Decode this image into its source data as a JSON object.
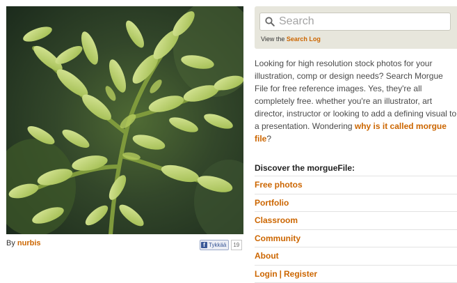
{
  "photo": {
    "credit_prefix": "By",
    "author": "nurbis",
    "like_label": "Tykkää",
    "like_count": "19"
  },
  "search": {
    "placeholder": "Search",
    "log_prefix": "View the",
    "log_link": "Search Log"
  },
  "intro": {
    "text": "Looking for high resolution stock photos for your illustration, comp or design needs? Search Morgue File for free reference images. Yes, they're all completely free. whether you're an illustrator, art director, instructor or looking to add a defining visual to a presentation. Wondering ",
    "link": "why is it called morgue file",
    "suffix": "?"
  },
  "discover": {
    "title": "Discover the morgueFile:",
    "items": [
      {
        "label": "Free photos"
      },
      {
        "label": "Portfolio"
      },
      {
        "label": "Classroom"
      },
      {
        "label": "Community"
      },
      {
        "label": "About"
      }
    ],
    "login": "Login",
    "separator": "|",
    "register": "Register"
  },
  "colors": {
    "accent": "#cc6600",
    "panel": "#e7e6dc"
  }
}
